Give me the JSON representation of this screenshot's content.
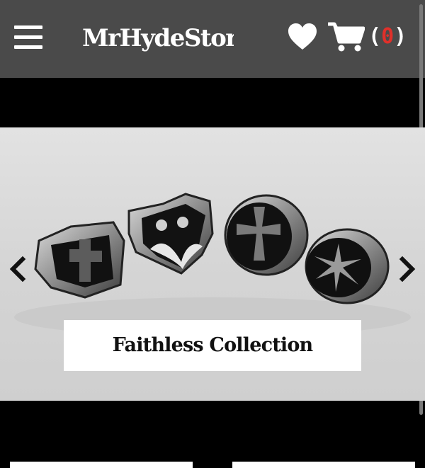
{
  "header": {
    "menu_icon": "hamburger-menu-icon",
    "logo_text": "MrHydeStore",
    "wishlist_icon": "heart-icon",
    "cart_icon": "shopping-cart-icon",
    "cart_open": "(",
    "cart_count": "0",
    "cart_close": ")",
    "cart_count_color": "#e0302a",
    "background_color": "#4a4a4a"
  },
  "slider": {
    "prev_icon": "chevron-left-icon",
    "next_icon": "chevron-right-icon",
    "caption": "Faithless Collection",
    "image_subject": "rings-product-image"
  }
}
